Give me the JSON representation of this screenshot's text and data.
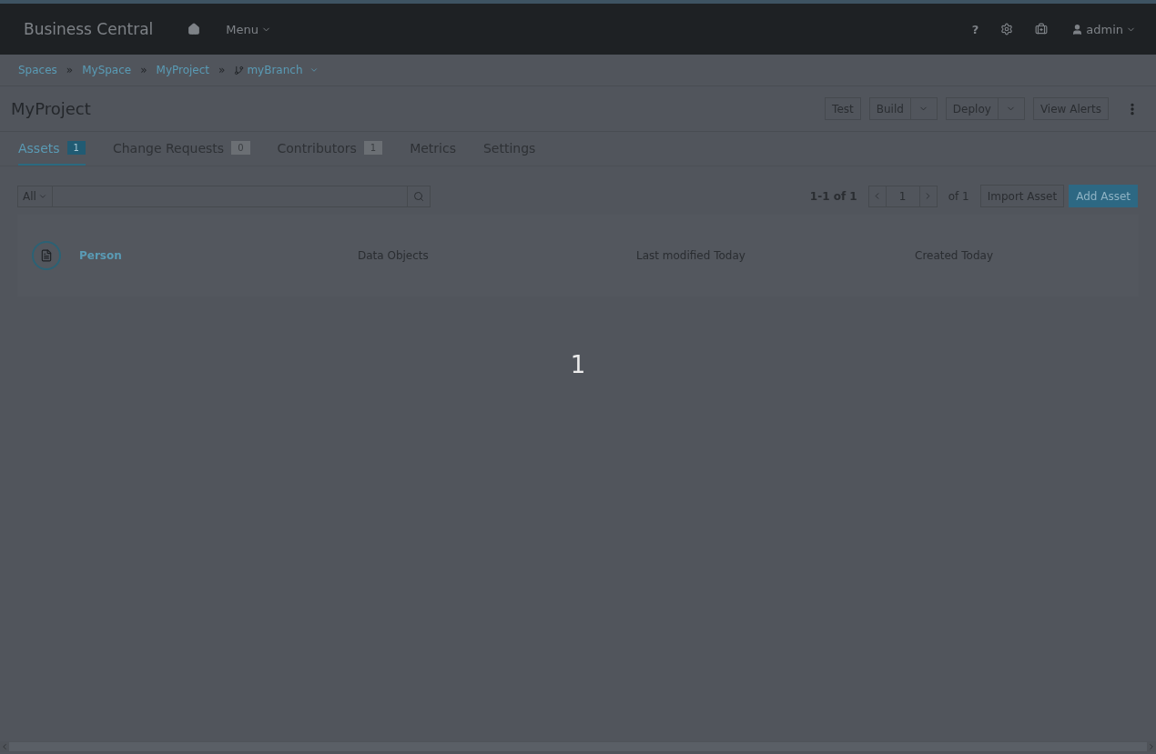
{
  "header": {
    "brand": "Business Central",
    "menu": "Menu",
    "help": "?",
    "user": "admin"
  },
  "breadcrumbs": [
    {
      "label": "Spaces",
      "separator": "»"
    },
    {
      "label": "MySpace",
      "separator": "»"
    },
    {
      "label": "MyProject",
      "separator": "»"
    }
  ],
  "branch": "myBranch",
  "project": {
    "title": "MyProject",
    "actions": [
      {
        "label": "Test",
        "kind": "plain"
      },
      {
        "label": "Build",
        "kind": "split"
      },
      {
        "label": "Deploy",
        "kind": "split"
      },
      {
        "label": "View Alerts",
        "kind": "plain"
      }
    ]
  },
  "tabs": [
    {
      "label": "Assets",
      "count": "1",
      "selected": true
    },
    {
      "label": "Change Requests",
      "count": "0",
      "selected": false
    },
    {
      "label": "Contributors",
      "count": "1",
      "selected": false
    },
    {
      "label": "Metrics",
      "selected": false
    },
    {
      "label": "Settings",
      "selected": false
    }
  ],
  "toolbar": {
    "filter": "All",
    "range": "1-1 of 1",
    "page": "1",
    "of": "of 1",
    "buttons": [
      {
        "label": "Import Asset",
        "kind": "default"
      },
      {
        "label": "Add Asset",
        "kind": "primary"
      }
    ]
  },
  "assets": [
    {
      "name": "Person",
      "type": "Data Objects",
      "modified": "Last modified Today",
      "created": "Created Today"
    }
  ],
  "step_marker": "1"
}
